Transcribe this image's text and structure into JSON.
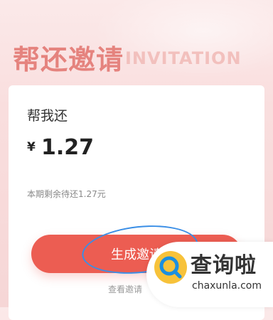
{
  "header": {
    "title_cn": "帮还邀请",
    "title_en": "INVITATION"
  },
  "card": {
    "label": "帮我还",
    "currency_symbol": "¥",
    "amount": "1.27",
    "remaining_text": "本期剩余待还1.27元",
    "primary_button": "生成邀请",
    "secondary_link": "查看邀请"
  },
  "watermark": {
    "name": "查询啦",
    "domain": "chaxunla.com"
  },
  "colors": {
    "accent": "#ec5d52",
    "title": "#e5837e",
    "ring": "#3a8ee6"
  }
}
